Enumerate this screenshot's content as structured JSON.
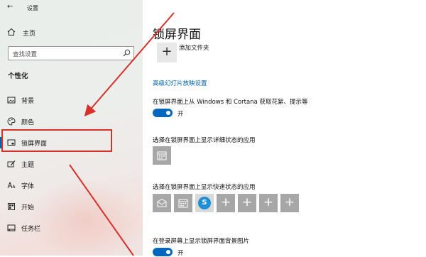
{
  "window": {
    "title": "设置",
    "back_glyph": "←"
  },
  "sidebar": {
    "home_label": "主页",
    "search_placeholder": "查找设置",
    "section_title": "个性化",
    "items": [
      {
        "label": "背景",
        "icon": "picture-icon"
      },
      {
        "label": "颜色",
        "icon": "palette-icon"
      },
      {
        "label": "锁屏界面",
        "icon": "lockscreen-icon",
        "active": true
      },
      {
        "label": "主题",
        "icon": "brush-icon"
      },
      {
        "label": "字体",
        "icon": "font-icon"
      },
      {
        "label": "开始",
        "icon": "start-icon"
      },
      {
        "label": "任务栏",
        "icon": "taskbar-icon"
      }
    ]
  },
  "main": {
    "title": "锁屏界面",
    "add_folder_label": "添加文件夹",
    "slideshow_link": "高级幻灯片放映设置",
    "fun_facts_label": "在锁屏界面上从 Windows 和 Cortana 获取花絮、提示等",
    "fun_facts_state": "开",
    "detailed_status_label": "选择在锁屏界面上显示详细状态的应用",
    "quick_status_label": "选择在锁屏界面上显示快速状态的应用",
    "signin_bg_label": "在登录屏幕上显示锁屏界面背景图片",
    "signin_bg_state": "开",
    "skype_letter": "S"
  },
  "colors": {
    "accent": "#0067c0",
    "link": "#0063b1",
    "annotation": "#d8302b",
    "tile": "#a7a7a7"
  }
}
